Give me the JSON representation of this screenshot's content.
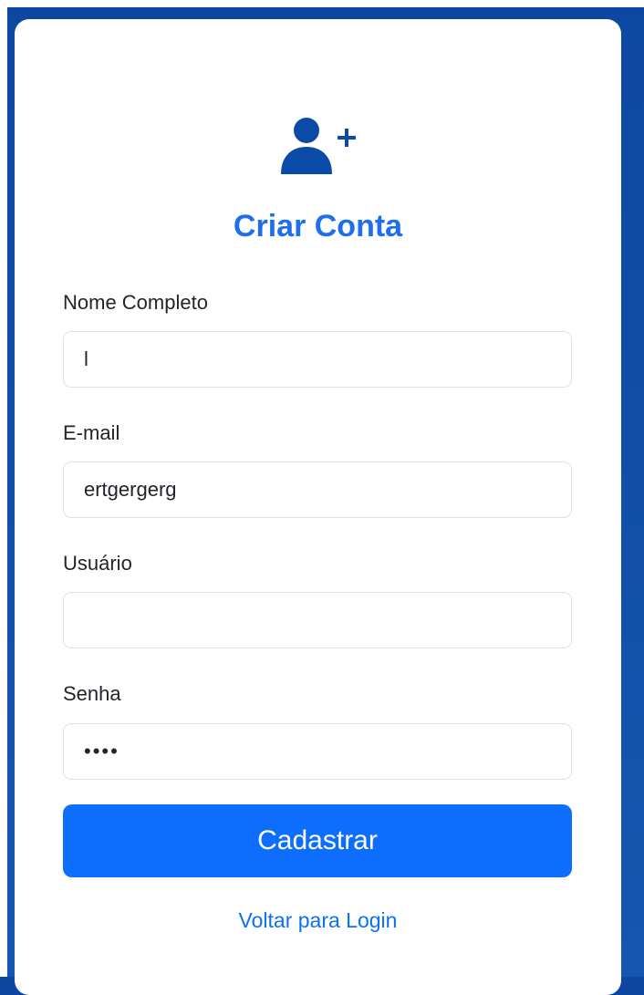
{
  "form": {
    "icon": "user-plus-icon",
    "title": "Criar Conta",
    "fields": [
      {
        "label": "Nome Completo",
        "value": "l",
        "placeholder": ""
      },
      {
        "label": "E-mail",
        "value": "ertgergerg",
        "placeholder": ""
      },
      {
        "label": "Usuário",
        "value": "",
        "placeholder": ""
      },
      {
        "label": "Senha",
        "value": "••••",
        "placeholder": ""
      }
    ],
    "submit_label": "Cadastrar",
    "back_link": "Voltar para Login"
  },
  "colors": {
    "background": "#0d47a1",
    "accent": "#0d6efd",
    "title": "#1e6ff0",
    "icon": "#0b4aa6"
  }
}
